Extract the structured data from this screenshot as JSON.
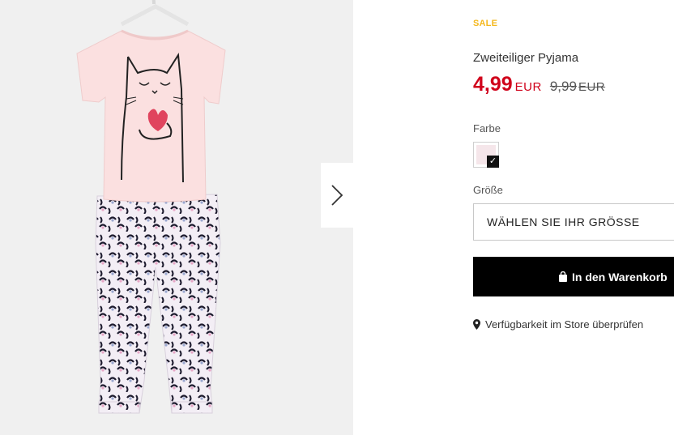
{
  "gallery": {
    "image_alt": "Zweiteiliger Pyjama",
    "next_icon": "chevron-right-icon"
  },
  "product": {
    "badge": "SALE",
    "title": "Zweiteiliger Pyjama",
    "price": {
      "current": "4,99",
      "currency": "EUR",
      "old": "9,99",
      "old_currency": "EUR"
    },
    "color": {
      "label": "Farbe",
      "selected_swatch": "#f5e6ea"
    },
    "size": {
      "label": "Größe",
      "placeholder": "WÄHLEN SIE IHR GRÖSSE"
    },
    "cart_button": {
      "label": "In den Warenkorb",
      "icon": "shopping-bag-icon"
    },
    "availability": {
      "label": "Verfügbarkeit im Store überprüfen",
      "icon": "map-pin-icon"
    }
  },
  "colors": {
    "sale": "#f4b81e",
    "price": "#d0021b",
    "button_bg": "#000000",
    "gallery_bg": "#f0f0f0"
  }
}
